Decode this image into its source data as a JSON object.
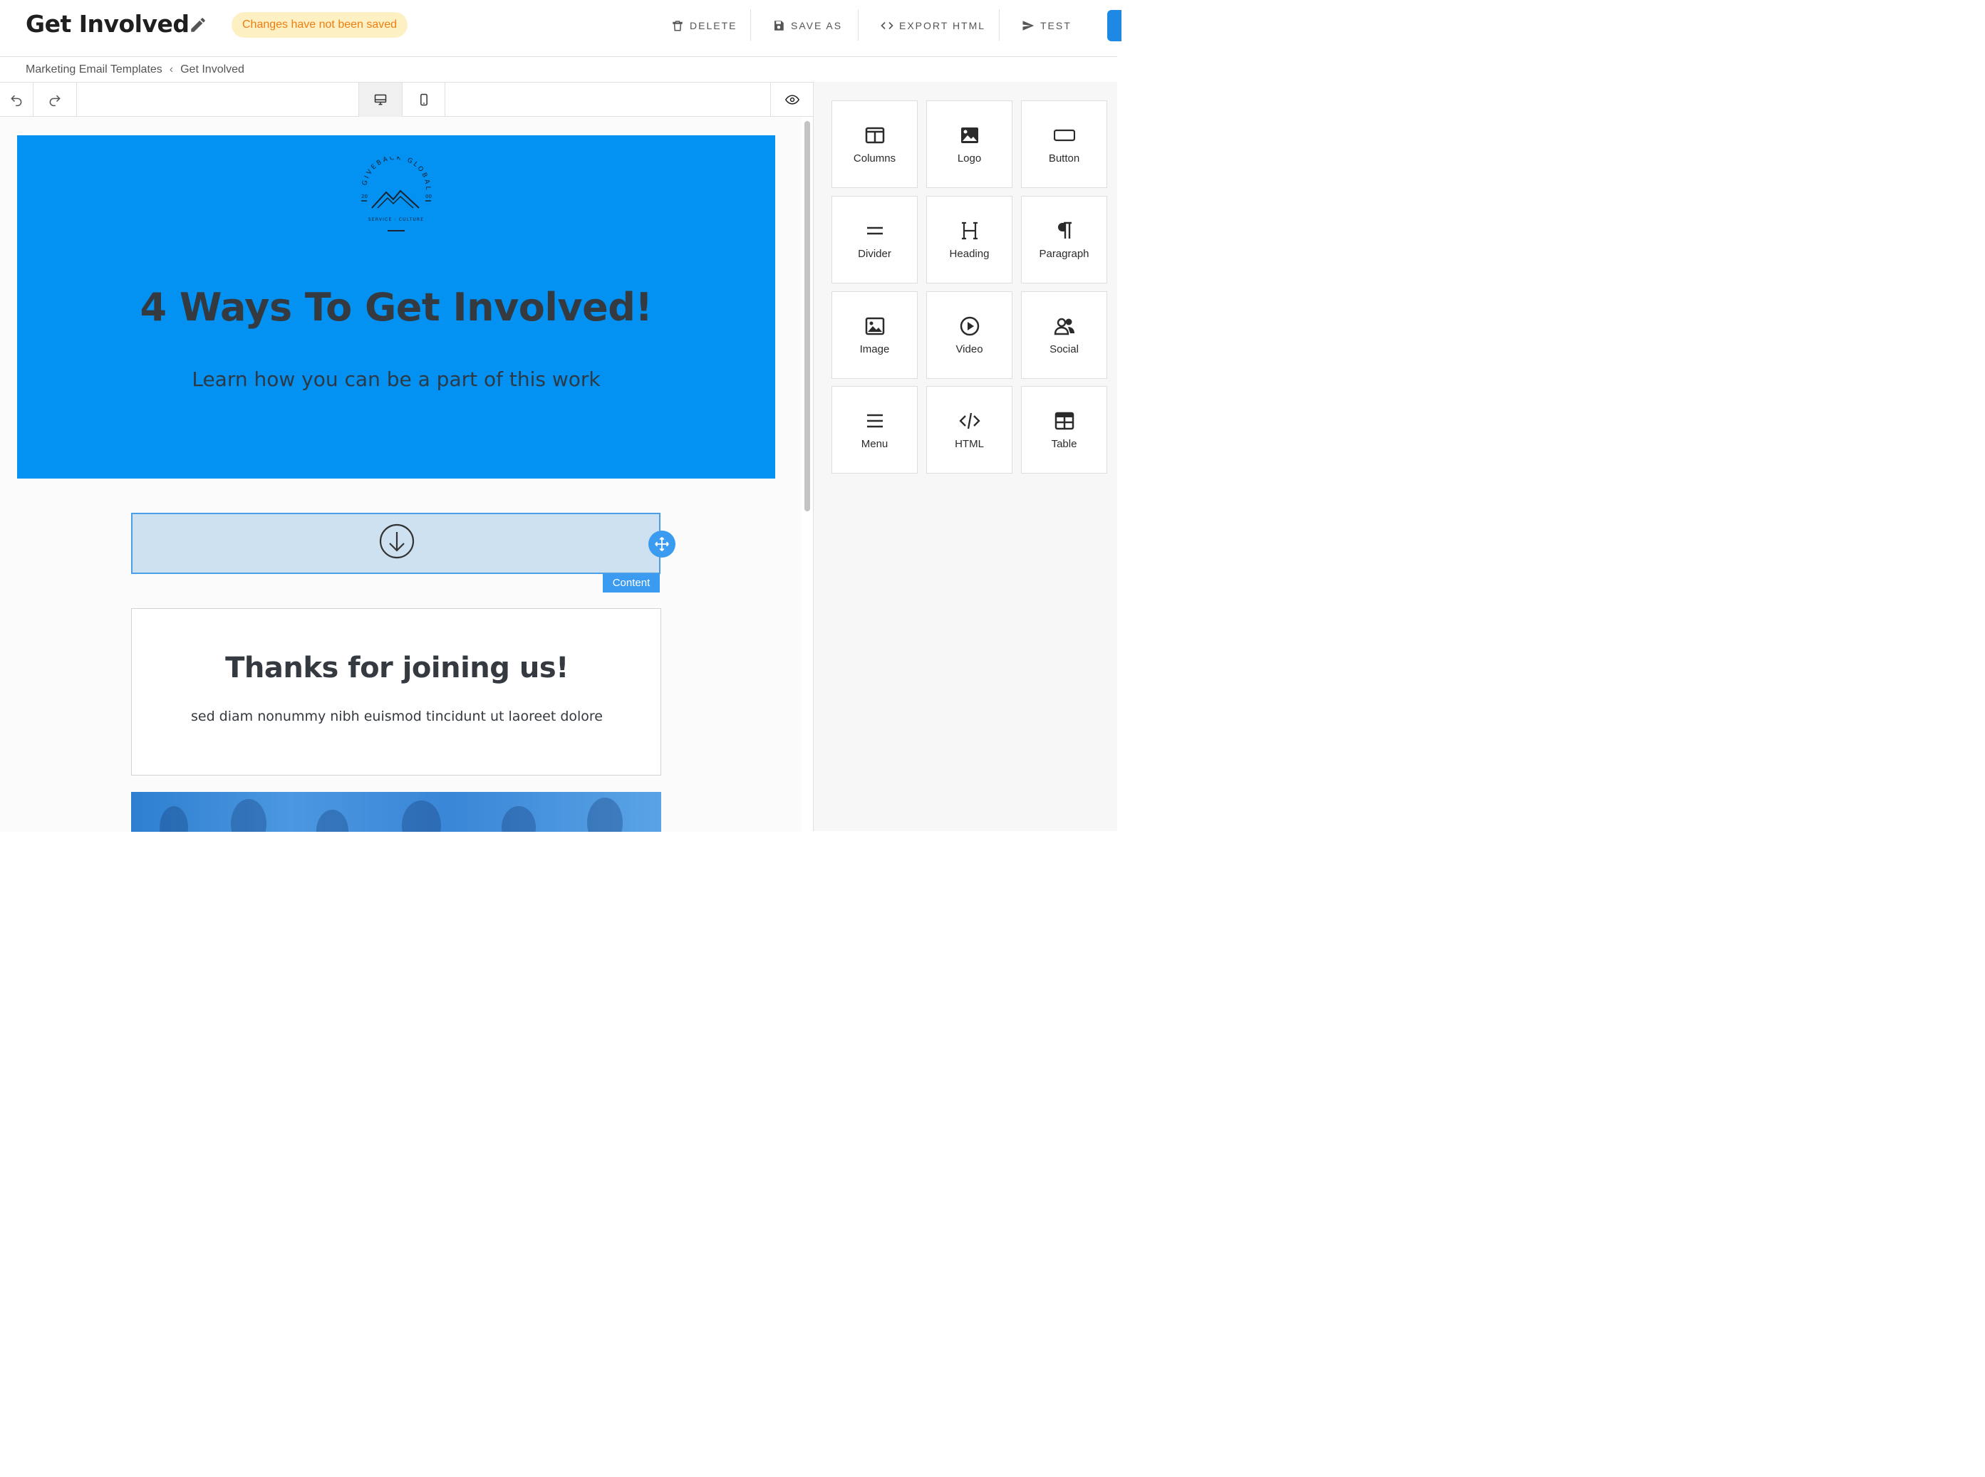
{
  "header": {
    "title": "Get Involved",
    "status_badge": "Changes have not been saved",
    "buttons": [
      {
        "label": "DELETE",
        "icon": "trash-icon"
      },
      {
        "label": "SAVE AS",
        "icon": "floppy-disk-icon"
      },
      {
        "label": "EXPORT HTML",
        "icon": "code-brackets-icon"
      },
      {
        "label": "TEST",
        "icon": "send-icon"
      }
    ]
  },
  "breadcrumb": {
    "parent": "Marketing Email Templates",
    "current": "Get Involved"
  },
  "toolbar": {
    "undo": "undo-icon",
    "redo": "redo-icon",
    "desktop": "desktop-icon",
    "mobile": "mobile-icon",
    "preview": "eye-icon"
  },
  "email": {
    "logo": {
      "arc_text": "GIVEBACK GLOBAL",
      "year_left": "20",
      "year_right": "00",
      "bottom_text": "SERVICE · CULTURE"
    },
    "hero_title": "4 Ways To Get Involved!",
    "hero_subtitle": "Learn how you can be a part of this work",
    "selected_block_label": "Content",
    "card_title": "Thanks for joining us!",
    "card_text": "sed diam nonummy nibh euismod tincidunt ut laoreet dolore"
  },
  "blocks": [
    {
      "label": "Columns",
      "icon": "columns-icon"
    },
    {
      "label": "Logo",
      "icon": "logo-image-icon"
    },
    {
      "label": "Button",
      "icon": "button-icon"
    },
    {
      "label": "Divider",
      "icon": "divider-icon"
    },
    {
      "label": "Heading",
      "icon": "heading-icon"
    },
    {
      "label": "Paragraph",
      "icon": "paragraph-icon"
    },
    {
      "label": "Image",
      "icon": "image-icon"
    },
    {
      "label": "Video",
      "icon": "video-icon"
    },
    {
      "label": "Social",
      "icon": "social-icon"
    },
    {
      "label": "Menu",
      "icon": "menu-icon"
    },
    {
      "label": "HTML",
      "icon": "html-icon"
    },
    {
      "label": "Table",
      "icon": "table-icon"
    }
  ],
  "colors": {
    "hero_background": "#0391f2",
    "accent": "#3a9bf0",
    "badge_text": "#f07d12",
    "badge_background": "#fdf0c2"
  }
}
